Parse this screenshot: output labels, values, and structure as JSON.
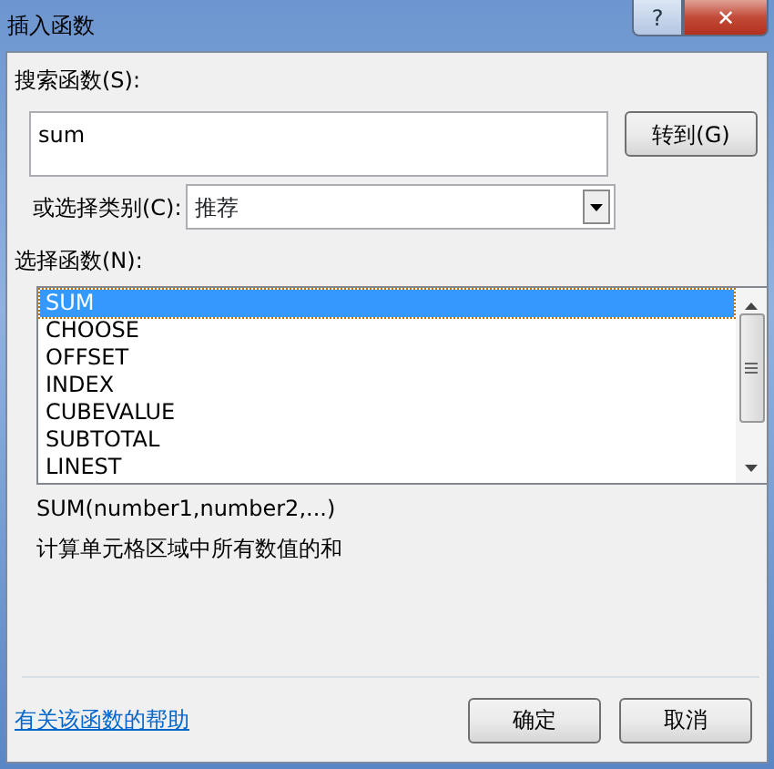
{
  "window": {
    "title": "插入函数",
    "help_button": "?",
    "close_button": "✕"
  },
  "search": {
    "label": "搜索函数(S):",
    "value": "sum",
    "go_button": "转到(G)"
  },
  "category": {
    "label": "或选择类别(C):",
    "value": "推荐"
  },
  "functions": {
    "label": "选择函数(N):",
    "items": [
      {
        "name": "SUM",
        "selected": true
      },
      {
        "name": "CHOOSE",
        "selected": false
      },
      {
        "name": "OFFSET",
        "selected": false
      },
      {
        "name": "INDEX",
        "selected": false
      },
      {
        "name": "CUBEVALUE",
        "selected": false
      },
      {
        "name": "SUBTOTAL",
        "selected": false
      },
      {
        "name": "LINEST",
        "selected": false
      }
    ]
  },
  "signature": "SUM(number1,number2,...)",
  "description": "计算单元格区域中所有数值的和",
  "help_link": "有关该函数的帮助",
  "buttons": [
    "确定",
    "取消"
  ]
}
